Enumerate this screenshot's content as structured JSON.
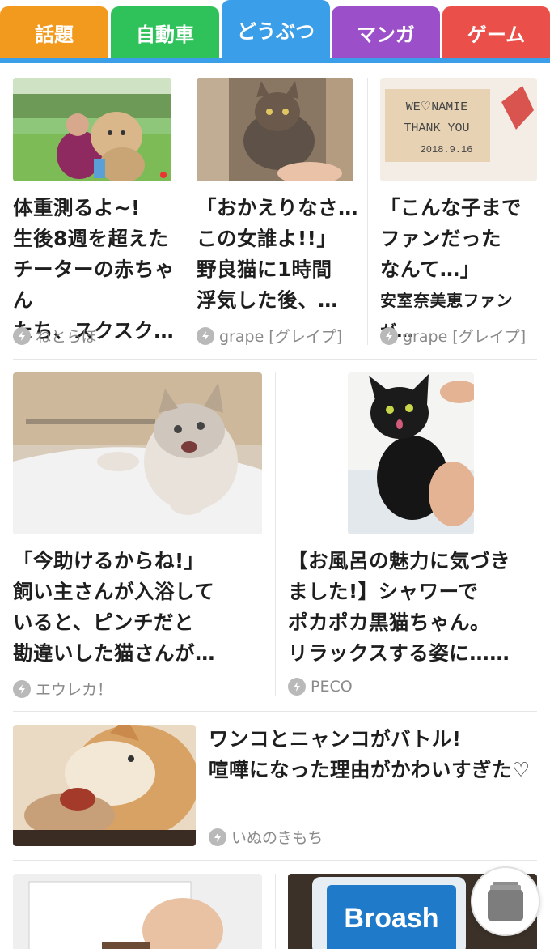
{
  "tabs": [
    {
      "label": "話題",
      "color": "#f29a1d"
    },
    {
      "label": "自動車",
      "color": "#2fc25b"
    },
    {
      "label": "どうぶつ",
      "color": "#3a9ee8",
      "active": true
    },
    {
      "label": "マンガ",
      "color": "#9b4fc9"
    },
    {
      "label": "ゲーム",
      "color": "#ea4f4a"
    }
  ],
  "articles": [
    {
      "title_lines": [
        "体重測るよ~!",
        "生後8週を超えた",
        "チーターの赤ちゃん",
        "たち、スクスク…"
      ],
      "source": "ねとらぼ"
    },
    {
      "title_lines": [
        "「おかえりなさ…",
        "この女誰よ!!」",
        "野良猫に1時間",
        "浮気した後、…"
      ],
      "source": "grape [グレイプ]"
    },
    {
      "title_lines": [
        "「こんな子まで",
        "ファンだった",
        "なんて…」",
        "安室奈美恵ファンが…"
      ],
      "source": "grape [グレイプ]",
      "photo_text": [
        "WE♡NAMIE",
        "THANK YOU",
        "2018.9.16"
      ]
    },
    {
      "title_lines": [
        "「今助けるからね!」",
        "飼い主さんが入浴して",
        "いると、ピンチだと",
        "勘違いした猫さんが…"
      ],
      "source": "エウレカ！"
    },
    {
      "title_lines": [
        "【お風呂の魅力に気づき",
        "ました!】シャワーで",
        "ポカポカ黒猫ちゃん。",
        "リラックスする姿に……"
      ],
      "source": "PECO"
    },
    {
      "title_lines": [
        "ワンコとニャンコがバトル!",
        "喧嘩になった理由がかわいすぎた♡"
      ],
      "source": "いぬのきもち"
    },
    {
      "title_lines": [],
      "source": ""
    },
    {
      "title_lines": [],
      "source": "",
      "photo_text": [
        "Broash"
      ]
    }
  ]
}
